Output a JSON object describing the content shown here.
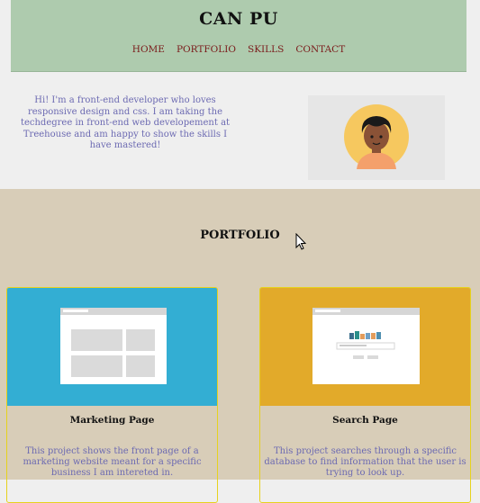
{
  "header": {
    "title": "CAN PU",
    "nav": [
      "HOME",
      "PORTFOLIO",
      "SKILLS",
      "CONTACT"
    ]
  },
  "intro": {
    "text": "Hi! I'm a front-end developer who loves responsive design and css. I am taking the techdegree in front-end web developement at Treehouse and am happy to show the skills I have mastered!"
  },
  "portfolio": {
    "title": "PORTFOLIO",
    "cards": [
      {
        "name": "Marketing Page",
        "description": "This project shows the front page of a marketing website meant for a specific business I am intereted in."
      },
      {
        "name": "Search Page",
        "description": "This project searches through a specific database to find information that the user is trying to look up."
      }
    ]
  },
  "colors": {
    "header_bg": "#aecbae",
    "nav_link": "#7a1a1a",
    "intro_text": "#6c6ab2",
    "portfolio_bg": "#d8cdb8",
    "card_one_bg": "#33aed3",
    "card_two_bg": "#e2aa2a",
    "card_border": "#e6d21e"
  },
  "icons": [
    "avatar-icon",
    "webpage-mockup-icon",
    "search-mockup-icon",
    "mouse-cursor-icon"
  ]
}
